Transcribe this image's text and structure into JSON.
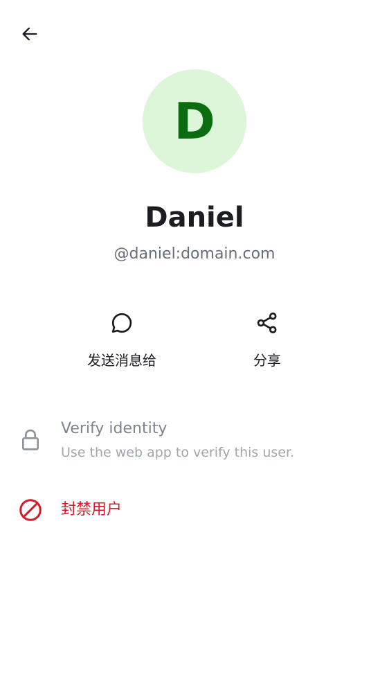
{
  "colors": {
    "avatar_bg": "#ddf5d9",
    "avatar_fg": "#0b6d10",
    "danger": "#d51928",
    "text_primary": "#1b1d22",
    "text_secondary": "#656d77",
    "disabled": "#7d848d"
  },
  "header": {
    "back_icon": "arrow-left-icon"
  },
  "profile": {
    "avatar_initial": "D",
    "display_name": "Daniel",
    "user_id": "@daniel:domain.com"
  },
  "actions": [
    {
      "icon": "chat-bubble-icon",
      "label": "发送消息给"
    },
    {
      "icon": "share-icon",
      "label": "分享"
    }
  ],
  "verify": {
    "icon": "lock-icon",
    "title": "Verify identity",
    "subtitle": "Use the web app to verify this user."
  },
  "ban": {
    "icon": "block-icon",
    "label": "封禁用户"
  }
}
